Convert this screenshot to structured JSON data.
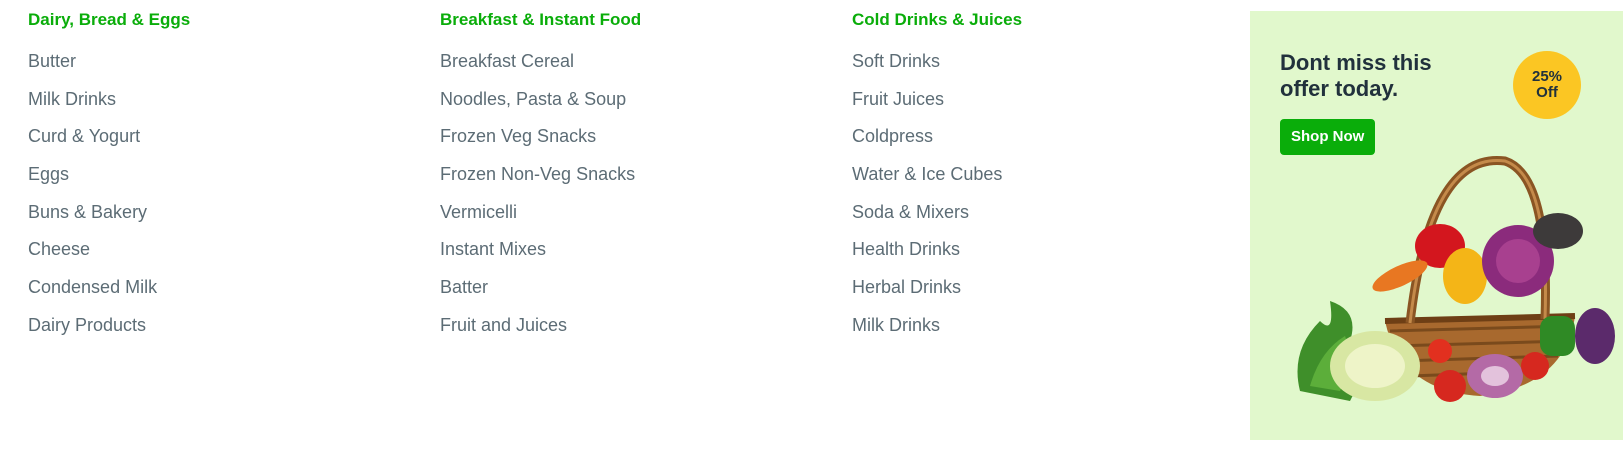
{
  "columns": [
    {
      "title": "Dairy, Bread & Eggs",
      "items": [
        "Butter",
        "Milk Drinks",
        "Curd & Yogurt",
        "Eggs",
        "Buns & Bakery",
        "Cheese",
        "Condensed Milk",
        "Dairy Products"
      ]
    },
    {
      "title": "Breakfast & Instant Food",
      "items": [
        "Breakfast Cereal",
        "Noodles, Pasta & Soup",
        "Frozen Veg Snacks",
        "Frozen Non-Veg Snacks",
        "Vermicelli",
        "Instant Mixes",
        "Batter",
        "Fruit and Juices"
      ]
    },
    {
      "title": "Cold Drinks & Juices",
      "items": [
        "Soft Drinks",
        "Fruit Juices",
        "Coldpress",
        "Water & Ice Cubes",
        "Soda & Mixers",
        "Health Drinks",
        "Herbal Drinks",
        "Milk Drinks"
      ]
    }
  ],
  "promo": {
    "title_line1": "Dont miss this",
    "title_line2": "offer today.",
    "badge_line1": "25%",
    "badge_line2": "Off",
    "button_label": "Shop Now",
    "image": "vegetable-basket-image"
  },
  "colors": {
    "accent": "#0aad0a",
    "text": "#5c6c75",
    "promo_bg": "#e1f8cc",
    "badge": "#fbc623"
  }
}
